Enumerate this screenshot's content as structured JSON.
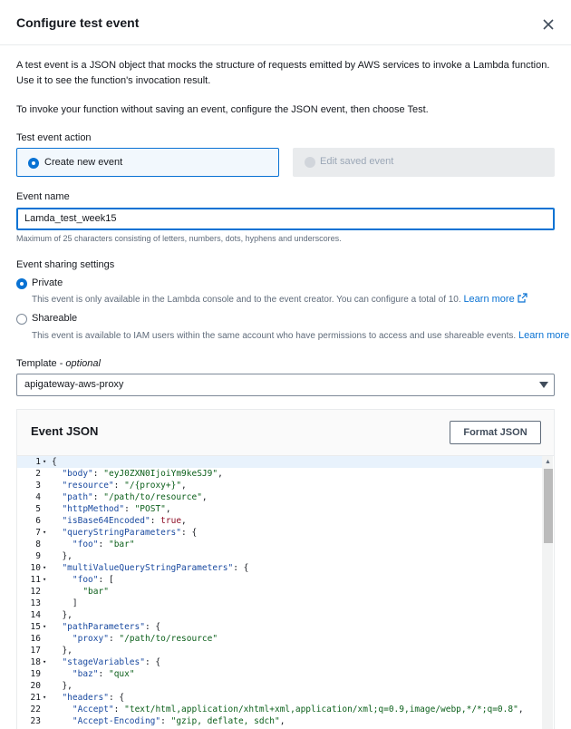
{
  "dialog": {
    "title": "Configure test event",
    "close_icon": "close-icon"
  },
  "intro": {
    "p1": "A test event is a JSON object that mocks the structure of requests emitted by AWS services to invoke a Lambda function. Use it to see the function's invocation result.",
    "p2": "To invoke your function without saving an event, configure the JSON event, then choose Test."
  },
  "action": {
    "label": "Test event action",
    "create": "Create new event",
    "edit": "Edit saved event",
    "selected": "create"
  },
  "event_name": {
    "label": "Event name",
    "value": "Lamda_test_week15",
    "hint": "Maximum of 25 characters consisting of letters, numbers, dots, hyphens and underscores."
  },
  "sharing": {
    "label": "Event sharing settings",
    "private_label": "Private",
    "private_desc": "This event is only available in the Lambda console and to the event creator. You can configure a total of 10.",
    "shareable_label": "Shareable",
    "shareable_desc": "This event is available to IAM users within the same account who have permissions to access and use shareable events.",
    "learn_more": "Learn more",
    "selected": "private"
  },
  "template": {
    "label": "Template",
    "optional": "optional",
    "value": "apigateway-aws-proxy"
  },
  "editor": {
    "title": "Event JSON",
    "format_button": "Format JSON",
    "lines": [
      {
        "n": "1",
        "fold": true,
        "text": "{"
      },
      {
        "n": "2",
        "fold": false,
        "text": "  \"body\": \"eyJ0ZXN0IjoiYm9keSJ9\","
      },
      {
        "n": "3",
        "fold": false,
        "text": "  \"resource\": \"/{proxy+}\","
      },
      {
        "n": "4",
        "fold": false,
        "text": "  \"path\": \"/path/to/resource\","
      },
      {
        "n": "5",
        "fold": false,
        "text": "  \"httpMethod\": \"POST\","
      },
      {
        "n": "6",
        "fold": false,
        "text": "  \"isBase64Encoded\": true,"
      },
      {
        "n": "7",
        "fold": true,
        "text": "  \"queryStringParameters\": {"
      },
      {
        "n": "8",
        "fold": false,
        "text": "    \"foo\": \"bar\""
      },
      {
        "n": "9",
        "fold": false,
        "text": "  },"
      },
      {
        "n": "10",
        "fold": true,
        "text": "  \"multiValueQueryStringParameters\": {"
      },
      {
        "n": "11",
        "fold": true,
        "text": "    \"foo\": ["
      },
      {
        "n": "12",
        "fold": false,
        "text": "      \"bar\""
      },
      {
        "n": "13",
        "fold": false,
        "text": "    ]"
      },
      {
        "n": "14",
        "fold": false,
        "text": "  },"
      },
      {
        "n": "15",
        "fold": true,
        "text": "  \"pathParameters\": {"
      },
      {
        "n": "16",
        "fold": false,
        "text": "    \"proxy\": \"/path/to/resource\""
      },
      {
        "n": "17",
        "fold": false,
        "text": "  },"
      },
      {
        "n": "18",
        "fold": true,
        "text": "  \"stageVariables\": {"
      },
      {
        "n": "19",
        "fold": false,
        "text": "    \"baz\": \"qux\""
      },
      {
        "n": "20",
        "fold": false,
        "text": "  },"
      },
      {
        "n": "21",
        "fold": true,
        "text": "  \"headers\": {"
      },
      {
        "n": "22",
        "fold": false,
        "text": "    \"Accept\": \"text/html,application/xhtml+xml,application/xml;q=0.9,image/webp,*/*;q=0.8\","
      },
      {
        "n": "23",
        "fold": false,
        "text": "    \"Accept-Encoding\": \"gzip, deflate, sdch\","
      }
    ]
  },
  "colors": {
    "accent": "#0972d3",
    "text": "#16191f",
    "muted": "#5f6b7a"
  }
}
